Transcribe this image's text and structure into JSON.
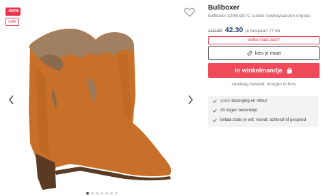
{
  "gallery": {
    "discount_badge": "-64%",
    "sale_badge": "sale",
    "image_alt": "bullboxer 329501E7C suède cowboylaarzen cognac",
    "total_images": 7,
    "active_image": 1
  },
  "product": {
    "brand": "Bullboxer",
    "subtitle": "bullboxer 329501E7C suède cowboylaarzen cognac",
    "old_price": "119.95",
    "new_price": "42.30",
    "saving": "je bespaart 77.65"
  },
  "actions": {
    "size_help": "welke maat past?",
    "choose_size": "kies je maat",
    "add_to_cart": "in winkelmandje"
  },
  "delivery": "vandaag besteld, morgen in huis",
  "usps": [
    {
      "highlight": "gratis",
      "text": " bezorging en retour"
    },
    {
      "highlight": "",
      "text": "30 dagen bedenktijd"
    },
    {
      "highlight": "",
      "text": "betaal zoals je wilt: vooraf, achteraf of gespreid"
    }
  ],
  "colors": {
    "accent": "#f04a5a",
    "badge": "#e8324a",
    "price": "#1f3b63",
    "boot": "#c8702a"
  },
  "icons": [
    "heart-icon",
    "chevron-left-icon",
    "chevron-right-icon",
    "ruler-icon",
    "shopping-bag-icon",
    "check-icon"
  ]
}
